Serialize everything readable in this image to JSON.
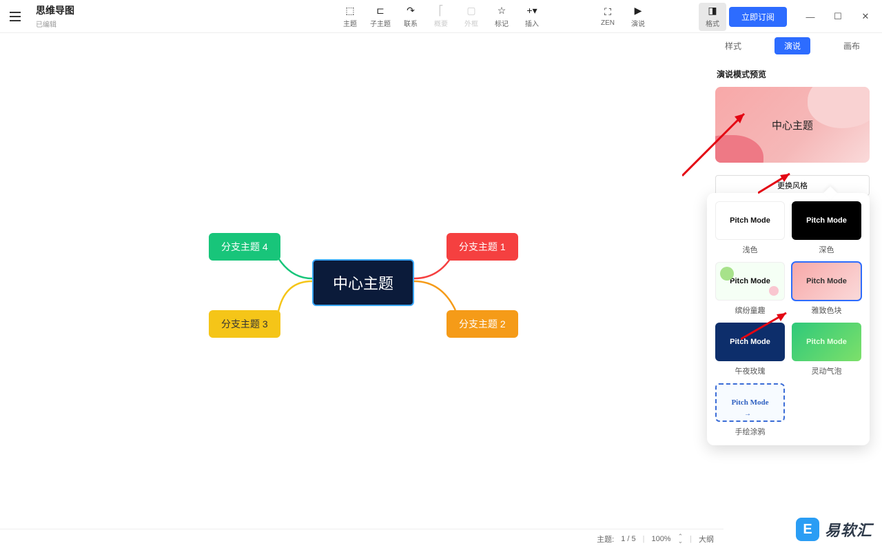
{
  "doc": {
    "title": "思维导图",
    "status": "已编辑"
  },
  "toolbar": {
    "topic": "主题",
    "subtopic": "子主题",
    "relation": "联系",
    "summary": "概要",
    "boundary": "外框",
    "marker": "标记",
    "insert": "插入",
    "zen": "ZEN",
    "present": "演说",
    "format": "格式"
  },
  "subscribe": "立即订阅",
  "mindmap": {
    "central": "中心主题",
    "branch1": "分支主题 1",
    "branch2": "分支主题 2",
    "branch3": "分支主题 3",
    "branch4": "分支主题 4"
  },
  "panel": {
    "tabs": {
      "style": "样式",
      "present": "演说",
      "canvas": "画布"
    },
    "section": "演说模式预览",
    "preview_text": "中心主题",
    "change": "更换风格"
  },
  "styles": {
    "s1": {
      "name": "浅色",
      "thumb": "Pitch Mode"
    },
    "s2": {
      "name": "深色",
      "thumb": "Pitch Mode"
    },
    "s3": {
      "name": "缤纷童趣",
      "thumb": "Pitch Mode"
    },
    "s4": {
      "name": "雅致色块",
      "thumb": "Pitch Mode"
    },
    "s5": {
      "name": "午夜玫瑰",
      "thumb": "Pitch Mode"
    },
    "s6": {
      "name": "灵动气泡",
      "thumb": "Pitch Mode"
    },
    "s7": {
      "name": "手绘涂鸦",
      "thumb": "Pitch Mode"
    }
  },
  "status": {
    "topic_label": "主题:",
    "topic_count": "1 / 5",
    "zoom": "100%",
    "outline": "大纲"
  },
  "watermark": "易软汇"
}
